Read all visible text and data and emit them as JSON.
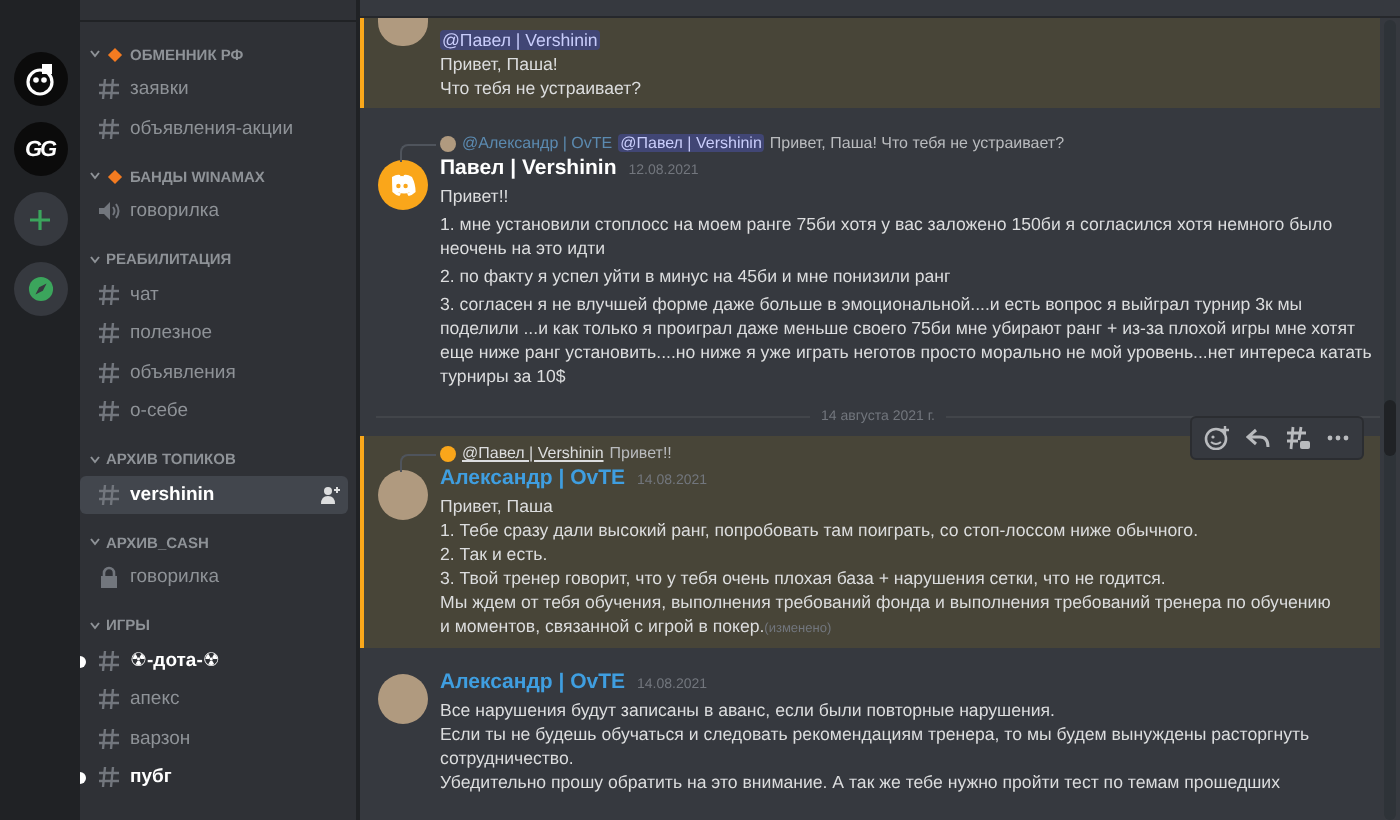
{
  "servers": [
    {
      "kind": "skull"
    },
    {
      "kind": "gg",
      "label": "GG"
    },
    {
      "kind": "add"
    },
    {
      "kind": "explore"
    }
  ],
  "sidebar": {
    "categories": [
      {
        "name": "ОБМЕННИК РФ",
        "marker": true,
        "channels": [
          {
            "name": "заявки",
            "kind": "text",
            "selected": false,
            "unread": false
          },
          {
            "name": "объявления-акции",
            "kind": "text",
            "selected": false,
            "unread": false
          }
        ]
      },
      {
        "name": "БАНДЫ WINAMAX",
        "marker": true,
        "channels": [
          {
            "name": "говорилка",
            "kind": "voice",
            "selected": false,
            "unread": false
          }
        ]
      },
      {
        "name": "РЕАБИЛИТАЦИЯ",
        "marker": false,
        "channels": [
          {
            "name": "чат",
            "kind": "text",
            "selected": false,
            "unread": false
          },
          {
            "name": "полезное",
            "kind": "text",
            "selected": false,
            "unread": false
          },
          {
            "name": "объявления",
            "kind": "text",
            "selected": false,
            "unread": false
          },
          {
            "name": "о-себе",
            "kind": "text",
            "selected": false,
            "unread": false
          }
        ]
      },
      {
        "name": "АРХИВ ТОПИКОВ",
        "marker": false,
        "channels": [
          {
            "name": "vershinin",
            "kind": "text",
            "selected": true,
            "unread": false
          }
        ]
      },
      {
        "name": "АРХИВ_CASH",
        "marker": false,
        "channels": [
          {
            "name": "говорилка",
            "kind": "locked",
            "selected": false,
            "unread": false
          }
        ]
      },
      {
        "name": "ИГРЫ",
        "marker": false,
        "channels": [
          {
            "name": "☢-дота-☢",
            "kind": "text",
            "selected": false,
            "unread": true
          },
          {
            "name": "апекс",
            "kind": "text",
            "selected": false,
            "unread": false
          },
          {
            "name": "варзон",
            "kind": "text",
            "selected": false,
            "unread": false
          },
          {
            "name": "пубг",
            "kind": "text",
            "selected": false,
            "unread": true
          }
        ]
      }
    ]
  },
  "messages": [
    {
      "kind": "continuation",
      "mentioned": true,
      "avatar": {
        "kind": "photo"
      },
      "mention": "@Павел | Vershinin",
      "paragraphs": [
        [
          "Привет, Паша!",
          "Что тебя не устраивает?"
        ]
      ]
    },
    {
      "kind": "full",
      "mentioned": false,
      "avatar": {
        "kind": "discord"
      },
      "reply": {
        "avatar": {
          "kind": "photo"
        },
        "author": "@Александр | OvTE",
        "mention": "@Павел | Vershinin",
        "text": "Привет, Паша! Что тебя не устраивает?"
      },
      "author": "Павел | Vershinin",
      "color": "#ffffff",
      "time": "12.08.2021",
      "paragraphs": [
        [
          "Привет!!"
        ],
        [
          "1. мне установили стоплосс на моем ранге 75би хотя у вас заложено 150би я согласился хотя немного было неочень на это идти"
        ],
        [
          "2. по факту я успел уйти в минус на 45би и мне понизили ранг"
        ],
        [
          "3. согласен я не влучшей форме даже больше в эмоциональной....и есть вопрос я выйграл турнир 3к мы поделили ...и как только я проиграл даже меньше своего 75би  мне убирают ранг + из-за плохой игры мне хотят еще ниже ранг установить....но ниже я уже играть неготов просто морально не мой уровень...нет интереса катать турниры за 10$"
        ]
      ]
    },
    {
      "kind": "divider",
      "text": "14 августа 2021 г."
    },
    {
      "kind": "full",
      "mentioned": true,
      "hovered": true,
      "avatar": {
        "kind": "photo"
      },
      "reply": {
        "avatar": {
          "kind": "discord"
        },
        "author": "@Павел | Vershinin",
        "text": "Привет!!"
      },
      "author": "Александр | OvTE",
      "color": "#3f9ee0",
      "time": "14.08.2021",
      "edited": "(изменено)",
      "paragraphs": [
        [
          "Привет, Паша",
          "1. Тебе сразу дали высокий ранг, попробовать там поиграть, со стоп-лоссом ниже обычного.",
          "2. Так и есть.",
          "3. Твой тренер говорит, что у тебя очень плохая база  + нарушения сетки, что не годится.",
          "Мы ждем от тебя обучения, выполнения требований фонда и выполнения требований тренера по обучению",
          "и моментов, связанной с игрой в покер."
        ]
      ]
    },
    {
      "kind": "full",
      "mentioned": false,
      "avatar": {
        "kind": "photo"
      },
      "author": "Александр | OvTE",
      "color": "#3f9ee0",
      "time": "14.08.2021",
      "paragraphs": [
        [
          "Все нарушения будут записаны в аванс, если были повторные нарушения.",
          "Если ты не будешь обучаться и следовать рекомендациям тренера, то мы будем вынуждены расторгнуть сотрудничество.",
          "Убедительно прошу обратить на это внимание. А так же тебе нужно пройти тест по темам прошедших"
        ]
      ]
    }
  ]
}
